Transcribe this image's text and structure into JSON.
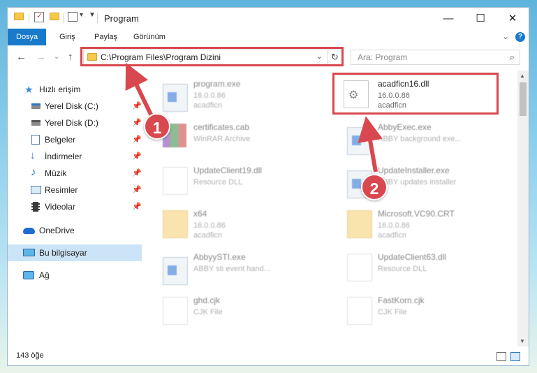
{
  "window": {
    "title": "Program",
    "controls": {
      "minimize": "—",
      "maximize": "☐",
      "close": "✕"
    }
  },
  "ribbon": {
    "tabs": [
      {
        "label": "Dosya",
        "active": true
      },
      {
        "label": "Giriş"
      },
      {
        "label": "Paylaş"
      },
      {
        "label": "Görünüm"
      }
    ],
    "collapse": "⌄",
    "help": "?"
  },
  "navbar": {
    "back": "←",
    "forward": "→",
    "recent": "⌄",
    "up": "↑",
    "address": "C:\\Program Files\\Program Dizini",
    "address_dropdown": "⌄",
    "refresh": "↻",
    "search_placeholder": "Ara: Program",
    "search_icon": "⌕"
  },
  "sidebar": {
    "items": [
      {
        "label": "Hızlı erişim",
        "icon": "star-icon"
      },
      {
        "label": "Yerel Disk (C:)",
        "icon": "drive-icon",
        "pinned": true
      },
      {
        "label": "Yerel Disk (D:)",
        "icon": "drive-icon",
        "pinned": true
      },
      {
        "label": "Belgeler",
        "icon": "documents-icon",
        "pinned": true
      },
      {
        "label": "İndirmeler",
        "icon": "download-icon",
        "pinned": true
      },
      {
        "label": "Müzik",
        "icon": "music-icon",
        "pinned": true
      },
      {
        "label": "Resimler",
        "icon": "pictures-icon",
        "pinned": true
      },
      {
        "label": "Videolar",
        "icon": "videos-icon",
        "pinned": true
      },
      {
        "label": "OneDrive",
        "icon": "cloud-icon"
      },
      {
        "label": "Bu bilgisayar",
        "icon": "computer-icon",
        "selected": true
      },
      {
        "label": "Ağ",
        "icon": "network-icon"
      }
    ],
    "pin_glyph": "📌"
  },
  "files": [
    {
      "name": "program.exe",
      "line1": "16.0.0.86",
      "line2": "acadficn",
      "kind": "exe",
      "faded": true
    },
    {
      "name": "acadficn16.dll",
      "line1": "16.0.0.86",
      "line2": "acadficn",
      "kind": "dll",
      "faded": false
    },
    {
      "name": "certificates.cab",
      "line1": "WinRAR Archive",
      "line2": "",
      "kind": "archive",
      "faded": true
    },
    {
      "name": "AbbyExec.exe",
      "line1": "ABBY background exe...",
      "line2": "",
      "kind": "exe",
      "faded": true
    },
    {
      "name": "UpdateClient19.dll",
      "line1": "Resource DLL",
      "line2": "",
      "kind": "doc",
      "faded": true
    },
    {
      "name": "UpdateInstaller.exe",
      "line1": "ABBY updates installer",
      "line2": "",
      "kind": "exe",
      "faded": true
    },
    {
      "name": "x64",
      "line1": "16.0.0.86",
      "line2": "acadficn",
      "kind": "folder",
      "faded": true
    },
    {
      "name": "Microsoft.VC90.CRT",
      "line1": "16.0.0.86",
      "line2": "acadficn",
      "kind": "folder",
      "faded": true
    },
    {
      "name": "AbbyySTI.exe",
      "line1": "ABBY sti event hand...",
      "line2": "",
      "kind": "exe",
      "faded": true
    },
    {
      "name": "UpdateClient63.dll",
      "line1": "Resource DLL",
      "line2": "",
      "kind": "doc",
      "faded": true
    },
    {
      "name": "ghd.cjk",
      "line1": "CJK File",
      "line2": "",
      "kind": "doc",
      "faded": true
    },
    {
      "name": "FastKorn.cjk",
      "line1": "CJK File",
      "line2": "",
      "kind": "doc",
      "faded": true
    }
  ],
  "status": {
    "count": "143 öğe"
  },
  "callouts": {
    "step1": "1",
    "step2": "2",
    "accent": "#d9484e"
  },
  "colors": {
    "ribbon_active": "#1979ca",
    "selection": "#cce4f7"
  }
}
